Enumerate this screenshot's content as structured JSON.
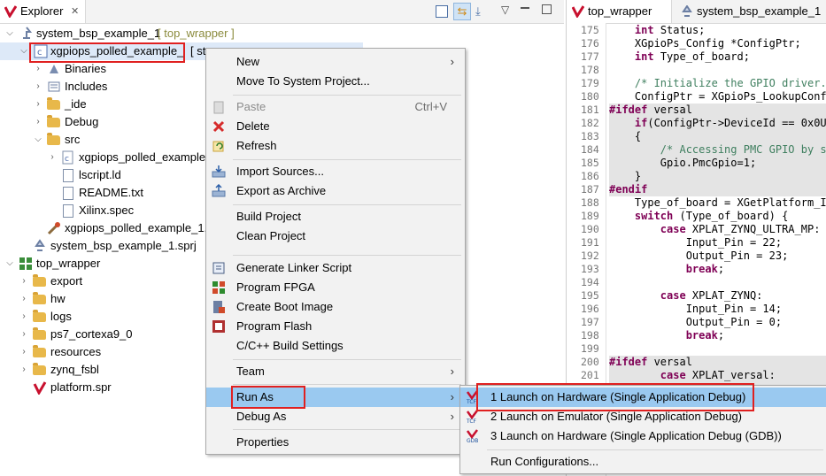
{
  "explorer": {
    "tab_label": "Explorer",
    "tree": [
      {
        "label": "system_bsp_example_1",
        "suffix": "[ top_wrapper ]"
      },
      {
        "label": "xgpiops_polled_example_",
        "suffix": "[ st..."
      },
      {
        "label": "Binaries"
      },
      {
        "label": "Includes"
      },
      {
        "label": "_ide"
      },
      {
        "label": "Debug"
      },
      {
        "label": "src"
      },
      {
        "label": "xgpiops_polled_example"
      },
      {
        "label": "lscript.ld"
      },
      {
        "label": "README.txt"
      },
      {
        "label": "Xilinx.spec"
      },
      {
        "label": "xgpiops_polled_example_1."
      },
      {
        "label": "system_bsp_example_1.sprj"
      },
      {
        "label": "top_wrapper"
      },
      {
        "label": "export"
      },
      {
        "label": "hw"
      },
      {
        "label": "logs"
      },
      {
        "label": "ps7_cortexa9_0"
      },
      {
        "label": "resources"
      },
      {
        "label": "zynq_fsbl"
      },
      {
        "label": "platform.spr"
      }
    ]
  },
  "editor": {
    "tabs": [
      "top_wrapper",
      "system_bsp_example_1"
    ],
    "lines": [
      {
        "n": "175",
        "pre": "    ",
        "kw": "int",
        "rest": " Status;"
      },
      {
        "n": "176",
        "pre": "    ",
        "kw": "",
        "rest": "XGpioPs_Config *ConfigPtr;"
      },
      {
        "n": "177",
        "pre": "    ",
        "kw": "int",
        "rest": " Type_of_board;"
      },
      {
        "n": "178",
        "pre": "",
        "kw": "",
        "rest": ""
      },
      {
        "n": "179",
        "pre": "    ",
        "kw": "",
        "rest": "/* Initialize the GPIO driver."
      },
      {
        "n": "180",
        "pre": "    ",
        "kw": "",
        "rest": "ConfigPtr = XGpioPs_LookupConfi"
      },
      {
        "n": "181",
        "pre": "",
        "kw": "#ifdef",
        "rest": " versal"
      },
      {
        "n": "182",
        "pre": "    ",
        "kw": "if",
        "rest": "(ConfigPtr->DeviceId == 0x0U)"
      },
      {
        "n": "183",
        "pre": "    ",
        "kw": "",
        "rest": "{"
      },
      {
        "n": "184",
        "pre": "        ",
        "kw": "",
        "rest": "/* Accessing PMC GPIO by se"
      },
      {
        "n": "185",
        "pre": "        ",
        "kw": "",
        "rest": "Gpio.PmcGpio=1;"
      },
      {
        "n": "186",
        "pre": "    ",
        "kw": "",
        "rest": "}"
      },
      {
        "n": "187",
        "pre": "",
        "kw": "#endif",
        "rest": ""
      },
      {
        "n": "188",
        "pre": "    ",
        "kw": "",
        "rest": "Type_of_board = XGetPlatform_In"
      },
      {
        "n": "189",
        "pre": "    ",
        "kw": "switch",
        "rest": " (Type_of_board) {"
      },
      {
        "n": "190",
        "pre": "        ",
        "kw": "case",
        "rest": " XPLAT_ZYNQ_ULTRA_MP:"
      },
      {
        "n": "191",
        "pre": "            ",
        "kw": "",
        "rest": "Input_Pin = 22;"
      },
      {
        "n": "192",
        "pre": "            ",
        "kw": "",
        "rest": "Output_Pin = 23;"
      },
      {
        "n": "193",
        "pre": "            ",
        "kw": "break",
        "rest": ";"
      },
      {
        "n": "194",
        "pre": "",
        "kw": "",
        "rest": ""
      },
      {
        "n": "195",
        "pre": "        ",
        "kw": "case",
        "rest": " XPLAT_ZYNQ:"
      },
      {
        "n": "196",
        "pre": "            ",
        "kw": "",
        "rest": "Input_Pin = 14;"
      },
      {
        "n": "197",
        "pre": "            ",
        "kw": "",
        "rest": "Output_Pin = 0;"
      },
      {
        "n": "198",
        "pre": "            ",
        "kw": "break",
        "rest": ";"
      },
      {
        "n": "199",
        "pre": "",
        "kw": "",
        "rest": ""
      },
      {
        "n": "200",
        "pre": "",
        "kw": "#ifdef",
        "rest": " versal"
      },
      {
        "n": "201",
        "pre": "        ",
        "kw": "case",
        "rest": " XPLAT_versal:"
      }
    ]
  },
  "context_menu": {
    "new": "New",
    "move_to_system": "Move To System Project...",
    "paste": "Paste",
    "paste_shortcut": "Ctrl+V",
    "delete": "Delete",
    "refresh": "Refresh",
    "import_sources": "Import Sources...",
    "export_archive": "Export as Archive",
    "build_project": "Build Project",
    "clean_project": "Clean Project",
    "gen_linker": "Generate Linker Script",
    "program_fpga": "Program FPGA",
    "create_boot": "Create Boot Image",
    "program_flash": "Program Flash",
    "cc_build": "C/C++ Build Settings",
    "team": "Team",
    "run_as": "Run As",
    "debug_as": "Debug As",
    "properties": "Properties"
  },
  "submenu": {
    "launch_hw": "1 Launch on Hardware (Single Application Debug)",
    "launch_emu": "2 Launch on Emulator (Single Application Debug)",
    "launch_gdb": "3 Launch on Hardware (Single Application Debug (GDB))",
    "run_configs": "Run Configurations..."
  },
  "colors": {
    "highlight": "#9ac9f0",
    "annotation": "#e02020",
    "folder": "#e8b84a"
  }
}
